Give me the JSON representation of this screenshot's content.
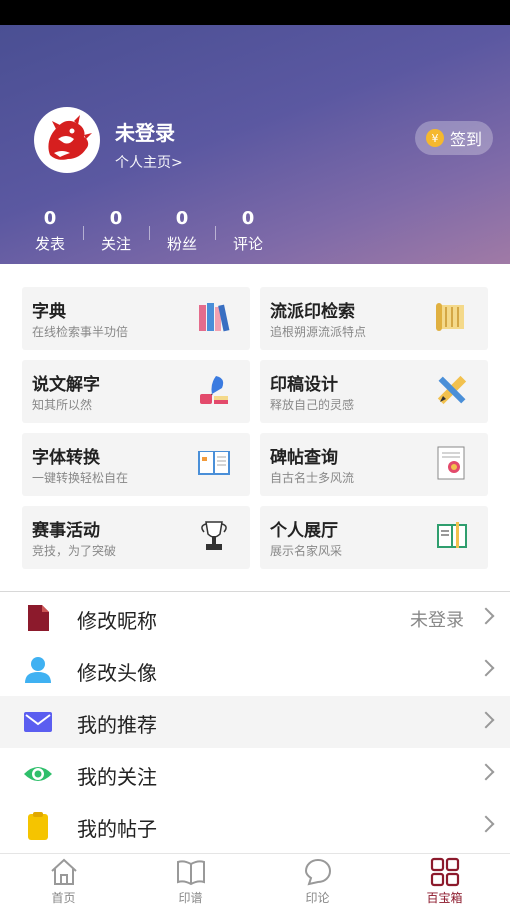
{
  "profile": {
    "username": "未登录",
    "homepage_link": "个人主页>",
    "checkin_label": "签到",
    "coin_symbol": "¥"
  },
  "stats": [
    {
      "value": "0",
      "label": "发表"
    },
    {
      "value": "0",
      "label": "关注"
    },
    {
      "value": "0",
      "label": "粉丝"
    },
    {
      "value": "0",
      "label": "评论"
    }
  ],
  "cards": [
    {
      "title": "字典",
      "subtitle": "在线检索事半功倍",
      "icon": "books-icon"
    },
    {
      "title": "流派印检索",
      "subtitle": "追根朔源流派特点",
      "icon": "scroll-icon"
    },
    {
      "title": "说文解字",
      "subtitle": "知其所以然",
      "icon": "quill-ink-icon"
    },
    {
      "title": "印稿设计",
      "subtitle": "释放自己的灵感",
      "icon": "pencil-ruler-icon"
    },
    {
      "title": "字体转换",
      "subtitle": "一键转换轻松自在",
      "icon": "open-book-icon"
    },
    {
      "title": "碑帖查询",
      "subtitle": "自古名士多风流",
      "icon": "certificate-icon"
    },
    {
      "title": "赛事活动",
      "subtitle": "竞技，为了突破",
      "icon": "trophy-icon"
    },
    {
      "title": "个人展厅",
      "subtitle": "展示名家风采",
      "icon": "notebook-icon"
    }
  ],
  "menu": [
    {
      "label": "修改昵称",
      "value": "未登录",
      "icon": "document-icon",
      "color": "#8c1a2c"
    },
    {
      "label": "修改头像",
      "value": "",
      "icon": "user-icon",
      "color": "#3fb1f2"
    },
    {
      "label": "我的推荐",
      "value": "",
      "icon": "mail-icon",
      "color": "#5b5ef0"
    },
    {
      "label": "我的关注",
      "value": "",
      "icon": "eye-icon",
      "color": "#2fbf6b"
    },
    {
      "label": "我的帖子",
      "value": "",
      "icon": "clipboard-icon",
      "color": "#f5c400"
    }
  ],
  "tabs": [
    {
      "label": "首页",
      "icon": "home-icon"
    },
    {
      "label": "印谱",
      "icon": "book-icon"
    },
    {
      "label": "印论",
      "icon": "chat-icon"
    },
    {
      "label": "百宝箱",
      "icon": "grid-icon",
      "active": true
    }
  ],
  "colors": {
    "accent": "#8c1a2c",
    "header_start": "#4a4f93",
    "header_end": "#a07aa6"
  }
}
